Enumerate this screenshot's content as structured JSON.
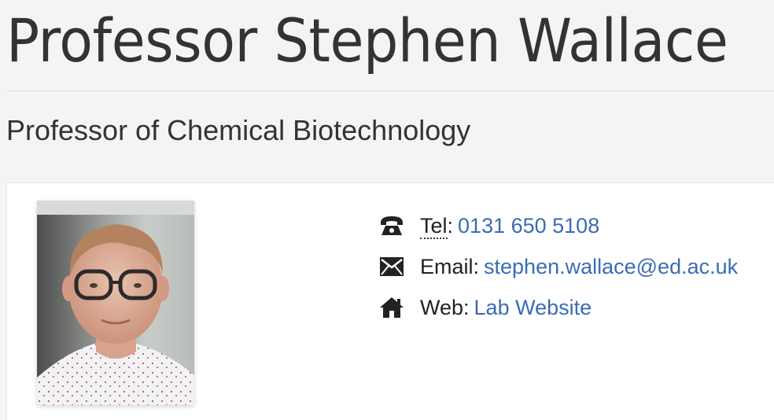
{
  "profile": {
    "name": "Professor Stephen Wallace",
    "position": "Professor of Chemical Biotechnology"
  },
  "contact": {
    "tel": {
      "label_abbr": "Tel",
      "label_suffix": ":",
      "value": "0131 650 5108",
      "icon": "phone-icon"
    },
    "email": {
      "label": "Email:",
      "value": "stephen.wallace@ed.ac.uk",
      "icon": "envelope-icon"
    },
    "web": {
      "label": "Web:",
      "value": "Lab Website",
      "icon": "home-icon"
    }
  },
  "colors": {
    "background": "#f4f4f4",
    "card": "#ffffff",
    "link": "#3a6cb4",
    "text": "#333333"
  }
}
